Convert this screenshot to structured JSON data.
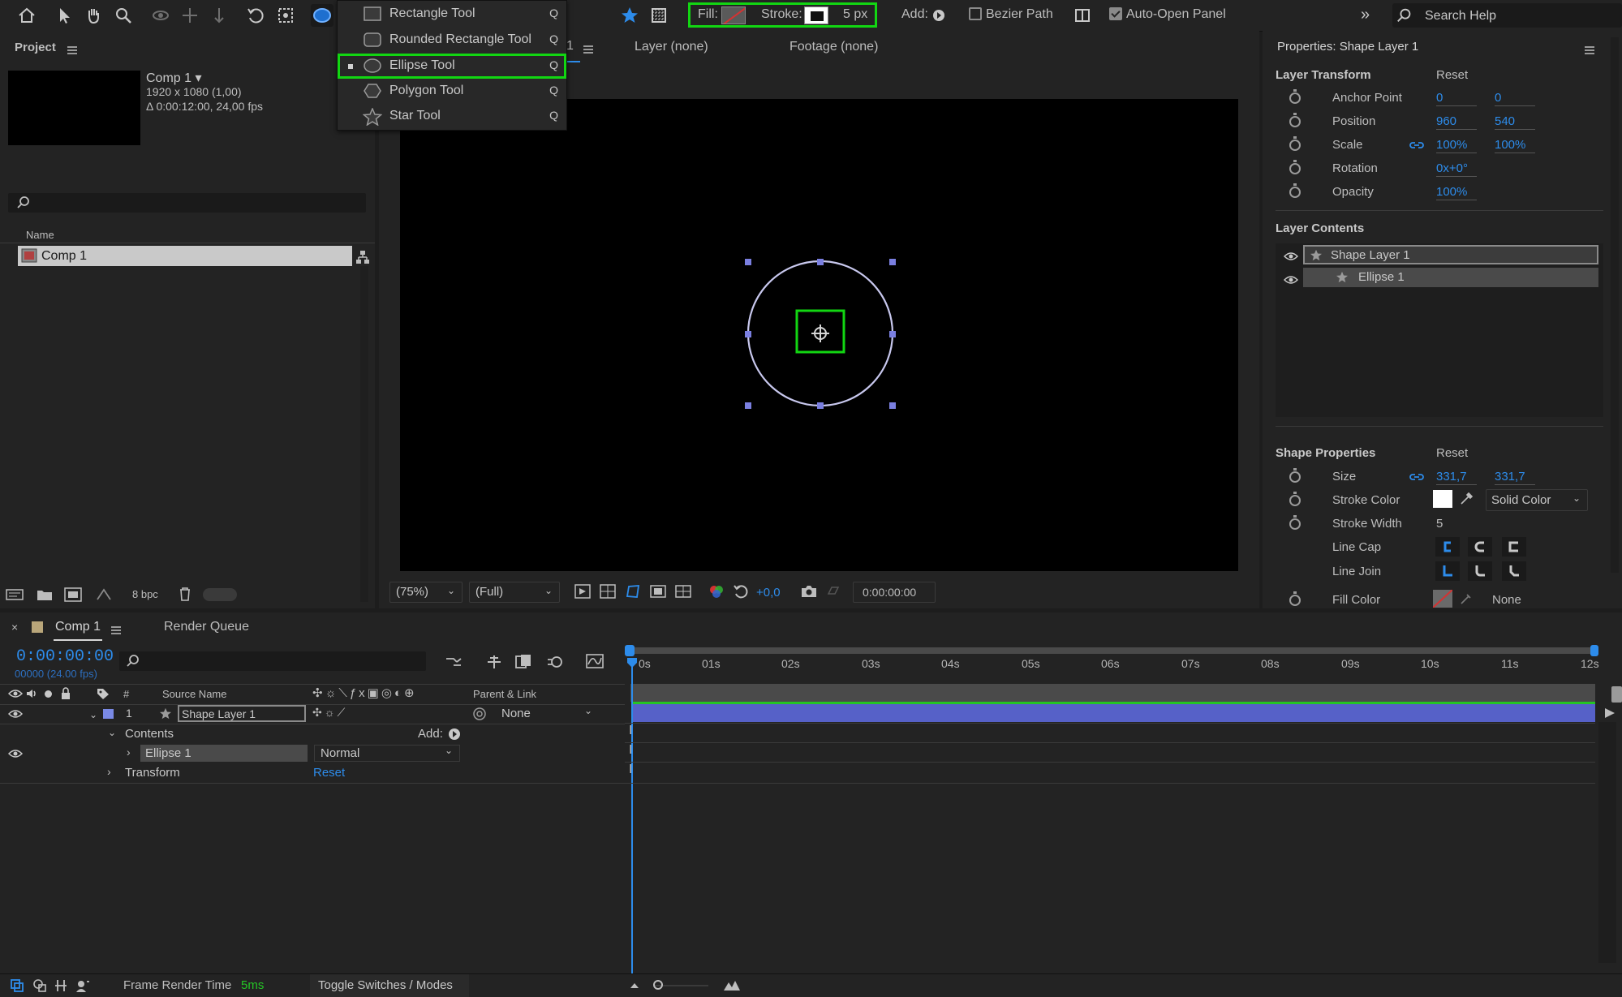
{
  "toolbar": {
    "fill_label": "Fill:",
    "stroke_label": "Stroke:",
    "stroke_width": "5 px",
    "add_label": "Add:",
    "bezier_label": "Bezier Path",
    "auto_open_label": "Auto-Open Panel",
    "search_placeholder": "Search Help",
    "accent": "#12d612"
  },
  "tool_menu": {
    "items": [
      {
        "label": "Rectangle Tool",
        "shortcut": "Q"
      },
      {
        "label": "Rounded Rectangle Tool",
        "shortcut": "Q"
      },
      {
        "label": "Ellipse Tool",
        "shortcut": "Q"
      },
      {
        "label": "Polygon Tool",
        "shortcut": "Q"
      },
      {
        "label": "Star Tool",
        "shortcut": "Q"
      }
    ]
  },
  "project": {
    "title": "Project",
    "comp_name": "Comp 1",
    "comp_size": "1920 x 1080 (1,00)",
    "comp_duration": "Δ 0:00:12:00, 24,00 fps",
    "column_name": "Name",
    "item": "Comp 1",
    "bpc": "8 bpc"
  },
  "comp_viewer": {
    "tab_num": "1",
    "layer_tab": "Layer (none)",
    "footage_tab": "Footage (none)",
    "zoom": "(75%)",
    "resolution": "(Full)",
    "exposure": "+0,0",
    "timecode": "0:00:00:00"
  },
  "properties": {
    "title": "Properties: Shape Layer 1",
    "layer_transform": "Layer Transform",
    "reset": "Reset",
    "anchor_label": "Anchor Point",
    "anchor_x": "0",
    "anchor_y": "0",
    "position_label": "Position",
    "position_x": "960",
    "position_y": "540",
    "scale_label": "Scale",
    "scale_x": "100%",
    "scale_y": "100%",
    "rotation_label": "Rotation",
    "rotation": "0x+0°",
    "opacity_label": "Opacity",
    "opacity": "100%",
    "layer_contents": "Layer Contents",
    "content_layer": "Shape Layer 1",
    "content_ellipse": "Ellipse 1",
    "shape_properties": "Shape Properties",
    "size_label": "Size",
    "size_w": "331,7",
    "size_h": "331,7",
    "stroke_color_label": "Stroke Color",
    "stroke_color_mode": "Solid Color",
    "stroke_width_label": "Stroke Width",
    "stroke_width": "5",
    "line_cap_label": "Line Cap",
    "line_join_label": "Line Join",
    "fill_color_label": "Fill Color",
    "fill_mode": "None"
  },
  "timeline": {
    "tab_comp": "Comp 1",
    "tab_render": "Render Queue",
    "timecode": "0:00:00:00",
    "fps_line": "00000 (24.00 fps)",
    "col_num": "#",
    "col_source": "Source Name",
    "col_parent": "Parent & Link",
    "layer_index": "1",
    "layer_name": "Shape Layer 1",
    "parent_value": "None",
    "contents_label": "Contents",
    "add_label": "Add:",
    "ellipse_label": "Ellipse 1",
    "blend_mode": "Normal",
    "transform_label": "Transform",
    "reset": "Reset",
    "ticks": [
      "0s",
      "01s",
      "02s",
      "03s",
      "04s",
      "05s",
      "06s",
      "07s",
      "08s",
      "09s",
      "10s",
      "11s",
      "12s"
    ]
  },
  "status": {
    "frame_render_label": "Frame Render Time",
    "frame_render_value": "5ms",
    "toggle_label": "Toggle Switches / Modes"
  }
}
